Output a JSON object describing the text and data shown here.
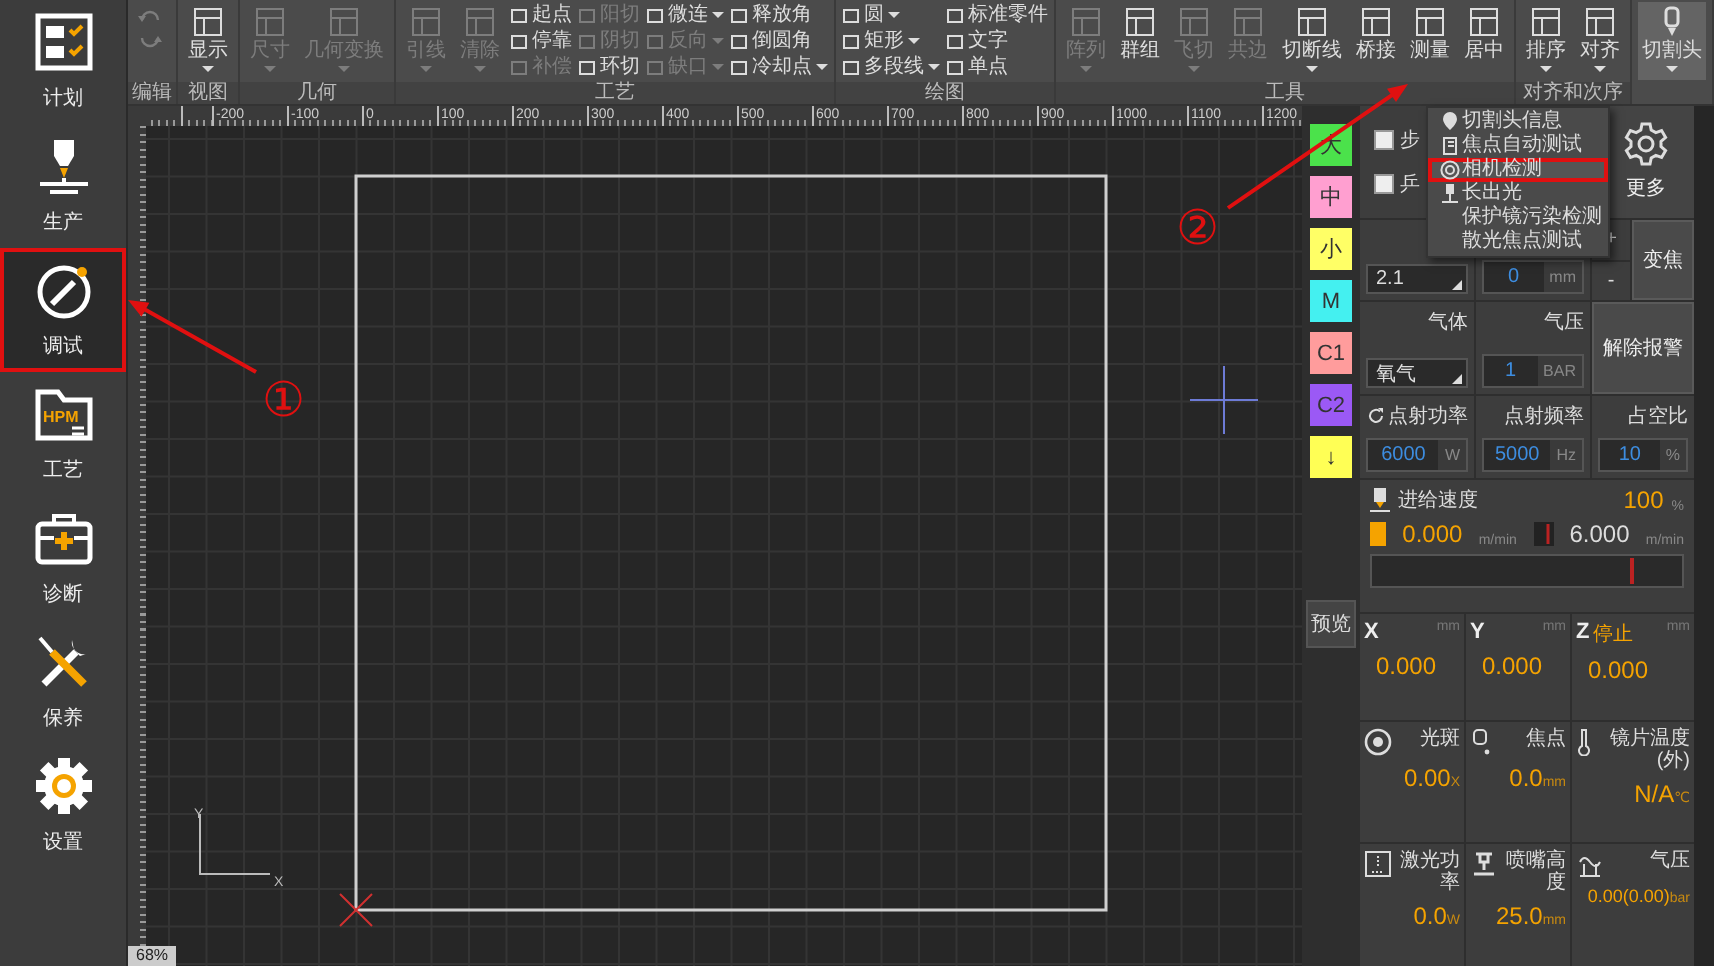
{
  "sidebar": {
    "items": [
      {
        "label": "计划",
        "selected": false,
        "highlighted": false
      },
      {
        "label": "生产",
        "selected": false,
        "highlighted": false
      },
      {
        "label": "调试",
        "selected": true,
        "highlighted": true
      },
      {
        "label": "工艺",
        "selected": false,
        "highlighted": false,
        "icon_text": "HPM"
      },
      {
        "label": "诊断",
        "selected": false,
        "highlighted": false
      },
      {
        "label": "保养",
        "selected": false,
        "highlighted": false
      },
      {
        "label": "设置",
        "selected": false,
        "highlighted": false
      }
    ]
  },
  "ribbon": {
    "groups": [
      {
        "label": "编辑",
        "items": [
          {
            "kind": "icon",
            "disabled": true,
            "expanded": false
          },
          {
            "kind": "icon",
            "disabled": true,
            "expanded": false
          }
        ]
      },
      {
        "label": "视图",
        "items": [
          {
            "kind": "large",
            "label": "显示",
            "dropdown": true,
            "disabled": false,
            "expanded": false
          }
        ]
      },
      {
        "label": "几何",
        "items": [
          {
            "kind": "large",
            "label": "尺寸",
            "dropdown": true,
            "disabled": true,
            "expanded": false
          },
          {
            "kind": "large",
            "label": "几何变换",
            "dropdown": true,
            "disabled": true,
            "expanded": false
          }
        ]
      },
      {
        "label": "工艺",
        "items": [
          {
            "kind": "large",
            "label": "引线",
            "dropdown": true,
            "disabled": true,
            "expanded": false
          },
          {
            "kind": "large",
            "label": "清除",
            "dropdown": true,
            "disabled": true,
            "expanded": false
          },
          {
            "kind": "small",
            "label": "起点",
            "dropdown": false,
            "disabled": false,
            "expanded": false
          },
          {
            "kind": "small",
            "label": "停靠",
            "dropdown": false,
            "disabled": false,
            "expanded": false
          },
          {
            "kind": "small",
            "label": "补偿",
            "dropdown": false,
            "disabled": true,
            "expanded": false
          },
          {
            "kind": "small",
            "label": "阳切",
            "dropdown": false,
            "disabled": true,
            "expanded": false
          },
          {
            "kind": "small",
            "label": "阴切",
            "dropdown": false,
            "disabled": true,
            "expanded": false
          },
          {
            "kind": "small",
            "label": "环切",
            "dropdown": false,
            "disabled": false,
            "expanded": false
          },
          {
            "kind": "small",
            "label": "微连",
            "dropdown": true,
            "disabled": false,
            "expanded": false
          },
          {
            "kind": "small",
            "label": "反向",
            "dropdown": true,
            "disabled": true,
            "expanded": false
          },
          {
            "kind": "small",
            "label": "缺口",
            "dropdown": true,
            "disabled": true,
            "expanded": false
          },
          {
            "kind": "small",
            "label": "释放角",
            "dropdown": false,
            "disabled": false,
            "expanded": false
          },
          {
            "kind": "small",
            "label": "倒圆角",
            "dropdown": false,
            "disabled": false,
            "expanded": false
          },
          {
            "kind": "small",
            "label": "冷却点",
            "dropdown": true,
            "disabled": false,
            "expanded": false
          }
        ]
      },
      {
        "label": "绘图",
        "items": [
          {
            "kind": "small",
            "label": "圆",
            "dropdown": true,
            "disabled": false,
            "expanded": false
          },
          {
            "kind": "small",
            "label": "矩形",
            "dropdown": true,
            "disabled": false,
            "expanded": false
          },
          {
            "kind": "small",
            "label": "多段线",
            "dropdown": true,
            "disabled": false,
            "expanded": false
          },
          {
            "kind": "small",
            "label": "标准零件",
            "dropdown": false,
            "disabled": false,
            "expanded": false
          },
          {
            "kind": "small",
            "label": "文字",
            "dropdown": false,
            "disabled": false,
            "expanded": false
          },
          {
            "kind": "small",
            "label": "单点",
            "dropdown": false,
            "disabled": false,
            "expanded": false
          }
        ]
      },
      {
        "label": "工具",
        "items": [
          {
            "kind": "large",
            "label": "阵列",
            "dropdown": true,
            "disabled": true,
            "expanded": false
          },
          {
            "kind": "large",
            "label": "群组",
            "dropdown": false,
            "disabled": false,
            "expanded": false
          },
          {
            "kind": "large",
            "label": "飞切",
            "dropdown": true,
            "disabled": true,
            "expanded": false
          },
          {
            "kind": "large",
            "label": "共边",
            "dropdown": false,
            "disabled": true,
            "expanded": false
          },
          {
            "kind": "large",
            "label": "切断线",
            "dropdown": true,
            "disabled": false,
            "expanded": false
          },
          {
            "kind": "large",
            "label": "桥接",
            "dropdown": false,
            "disabled": false,
            "expanded": false
          },
          {
            "kind": "large",
            "label": "测量",
            "dropdown": false,
            "disabled": false,
            "expanded": false
          },
          {
            "kind": "large",
            "label": "居中",
            "dropdown": false,
            "disabled": false,
            "expanded": false
          }
        ]
      },
      {
        "label": "对齐和次序",
        "items": [
          {
            "kind": "large",
            "label": "排序",
            "dropdown": true,
            "disabled": false,
            "expanded": false
          },
          {
            "kind": "large",
            "label": "对齐",
            "dropdown": true,
            "disabled": false,
            "expanded": false
          }
        ]
      },
      {
        "items": [
          {
            "kind": "large",
            "label": "切割头",
            "dropdown": true,
            "disabled": false,
            "expanded": true
          }
        ]
      }
    ]
  },
  "cutting_head_menu": {
    "items": [
      {
        "label": "切割头信息",
        "highlighted": false
      },
      {
        "label": "焦点自动测试",
        "highlighted": false
      },
      {
        "label": "相机检测",
        "highlighted": true
      },
      {
        "label": "长出光",
        "highlighted": false
      },
      {
        "label": "保护镜污染检测",
        "highlighted": false
      },
      {
        "label": "散光焦点测试",
        "highlighted": false
      }
    ]
  },
  "canvas": {
    "ruler_labels": [
      "-200",
      "-100",
      "0",
      "100",
      "200",
      "300",
      "400",
      "500",
      "600",
      "700",
      "800",
      "900",
      "1000",
      "1100",
      "1200"
    ],
    "axis_labels": [
      "X",
      "Y"
    ],
    "zoom": "68%"
  },
  "layers": [
    {
      "label": "大",
      "color": "#4be24b"
    },
    {
      "label": "中",
      "color": "#ff9fd0"
    },
    {
      "label": "小",
      "color": "#ffff66"
    },
    {
      "label": "M",
      "color": "#44f0f0"
    },
    {
      "label": "C1",
      "color": "#ff9c9c"
    },
    {
      "label": "C2",
      "color": "#9b59f5"
    },
    {
      "label": "↓",
      "color": "#ffff55"
    }
  ],
  "preview_button": "预览",
  "panel": {
    "options": [
      {
        "label": "步",
        "checked": false
      },
      {
        "label": "乒",
        "checked": false
      }
    ],
    "more_button": "更多",
    "lens": {
      "value": "2.1"
    },
    "zoom_field": {
      "value": "0",
      "unit": "mm"
    },
    "step_buttons": [
      "+",
      "-"
    ],
    "zoom_button": "变焦",
    "gas": {
      "label": "气体",
      "value": "氧气"
    },
    "pressure": {
      "label": "气压",
      "value": "1",
      "unit": "BAR"
    },
    "alarm_button": "解除报警",
    "pulse": [
      {
        "label": "点射功率",
        "value": "6000",
        "unit": "W"
      },
      {
        "label": "点射频率",
        "value": "5000",
        "unit": "Hz"
      },
      {
        "label": "占空比",
        "value": "10",
        "unit": "%"
      }
    ]
  },
  "feed": {
    "label": "进给速度",
    "percent": "100",
    "percent_unit": "%",
    "current": "0.000",
    "current_unit": "m/min",
    "max": "6.000",
    "max_unit": "m/min",
    "level": 0.84
  },
  "readouts": [
    {
      "kind": "axis",
      "label": "X",
      "unit": "mm",
      "value": "0.000"
    },
    {
      "kind": "axis",
      "label": "Y",
      "unit": "mm",
      "value": "0.000"
    },
    {
      "kind": "axis",
      "label": "Z",
      "status": "停止",
      "unit": "mm",
      "value": "0.000"
    },
    {
      "kind": "sensor",
      "label": "光斑",
      "value": "0.00",
      "unit": "X"
    },
    {
      "kind": "sensor",
      "label": "焦点",
      "value": "0.0",
      "unit": "mm"
    },
    {
      "kind": "sensor",
      "label": "镜片温度(外)",
      "value": "N/A",
      "unit": "℃"
    },
    {
      "kind": "sensor",
      "label": "激光功率",
      "value": "0.0",
      "unit": "W"
    },
    {
      "kind": "sensor",
      "label": "喷嘴高度",
      "value": "25.0",
      "unit": "mm"
    },
    {
      "kind": "sensor",
      "label": "气压",
      "value": "0.00(0.00)",
      "unit": "bar"
    }
  ],
  "annotations": [
    {
      "label": "①"
    },
    {
      "label": "②"
    }
  ]
}
